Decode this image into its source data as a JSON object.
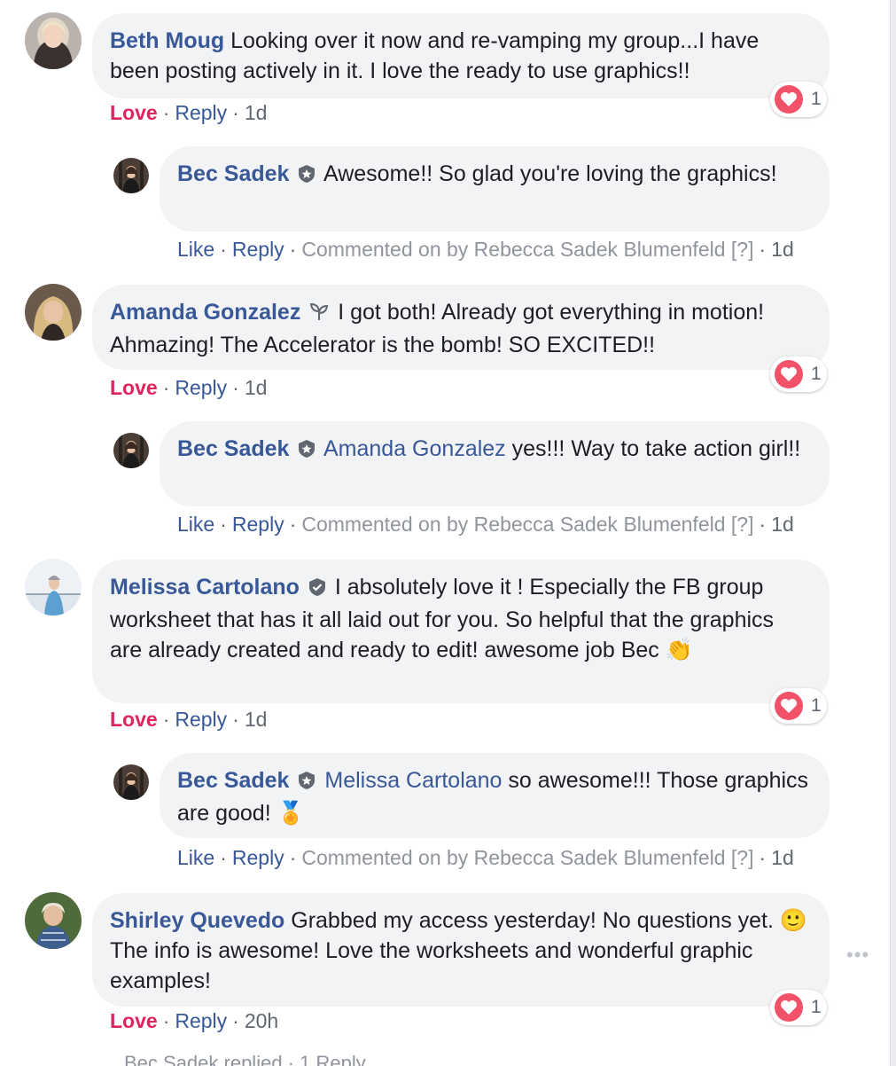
{
  "comments": [
    {
      "author": "Beth Moug",
      "text": "Looking over it now and re-vamping my group...I have been posting actively in it. I love the ready to use graphics!!",
      "react_count": "1",
      "love": "Love",
      "reply": "Reply",
      "time": "1d",
      "reply_item": {
        "author": "Bec Sadek",
        "mention": "",
        "text": "Awesome!! So glad you're loving the graphics!",
        "like": "Like",
        "reply": "Reply",
        "note": "Commented on by Rebecca Sadek Blumenfeld",
        "help": "[?]",
        "time": "1d"
      }
    },
    {
      "author": "Amanda Gonzalez",
      "text": "I got both! Already got everything in motion! Ahmazing! The Accelerator is the bomb! SO EXCITED!!",
      "react_count": "1",
      "love": "Love",
      "reply": "Reply",
      "time": "1d",
      "reply_item": {
        "author": "Bec Sadek",
        "mention": "Amanda Gonzalez",
        "text": "yes!!! Way to take action girl!!",
        "like": "Like",
        "reply": "Reply",
        "note": "Commented on by Rebecca Sadek Blumenfeld",
        "help": "[?]",
        "time": "1d"
      }
    },
    {
      "author": "Melissa Cartolano",
      "text": "I absolutely love it ! Especially the FB group worksheet that has it all laid out for you. So helpful that the graphics are already created and ready to edit! awesome job Bec",
      "emoji": "👏",
      "react_count": "1",
      "love": "Love",
      "reply": "Reply",
      "time": "1d",
      "reply_item": {
        "author": "Bec Sadek",
        "mention": "Melissa Cartolano",
        "text": "so awesome!!! Those graphics are good!",
        "emoji": "🏅",
        "like": "Like",
        "reply": "Reply",
        "note": "Commented on by Rebecca Sadek Blumenfeld",
        "help": "[?]",
        "time": "1d"
      }
    },
    {
      "author": "Shirley Quevedo",
      "text_a": "Grabbed my access yesterday! No questions yet.",
      "emoji": "🙂",
      "text_b": "The info is awesome! Love the worksheets and wonderful graphic examples!",
      "react_count": "1",
      "love": "Love",
      "reply": "Reply",
      "time": "20h"
    }
  ],
  "cutoff_text": "Bec Sadek replied · 1 Reply",
  "colors": {
    "link": "#385898",
    "love": "#e0245e",
    "bubble": "#f2f3f5",
    "meta": "#606770"
  },
  "icons": [
    "admin-shield-icon",
    "sprout-badge-icon",
    "verified-badge-icon",
    "love-reaction-icon",
    "more-options-icon"
  ]
}
